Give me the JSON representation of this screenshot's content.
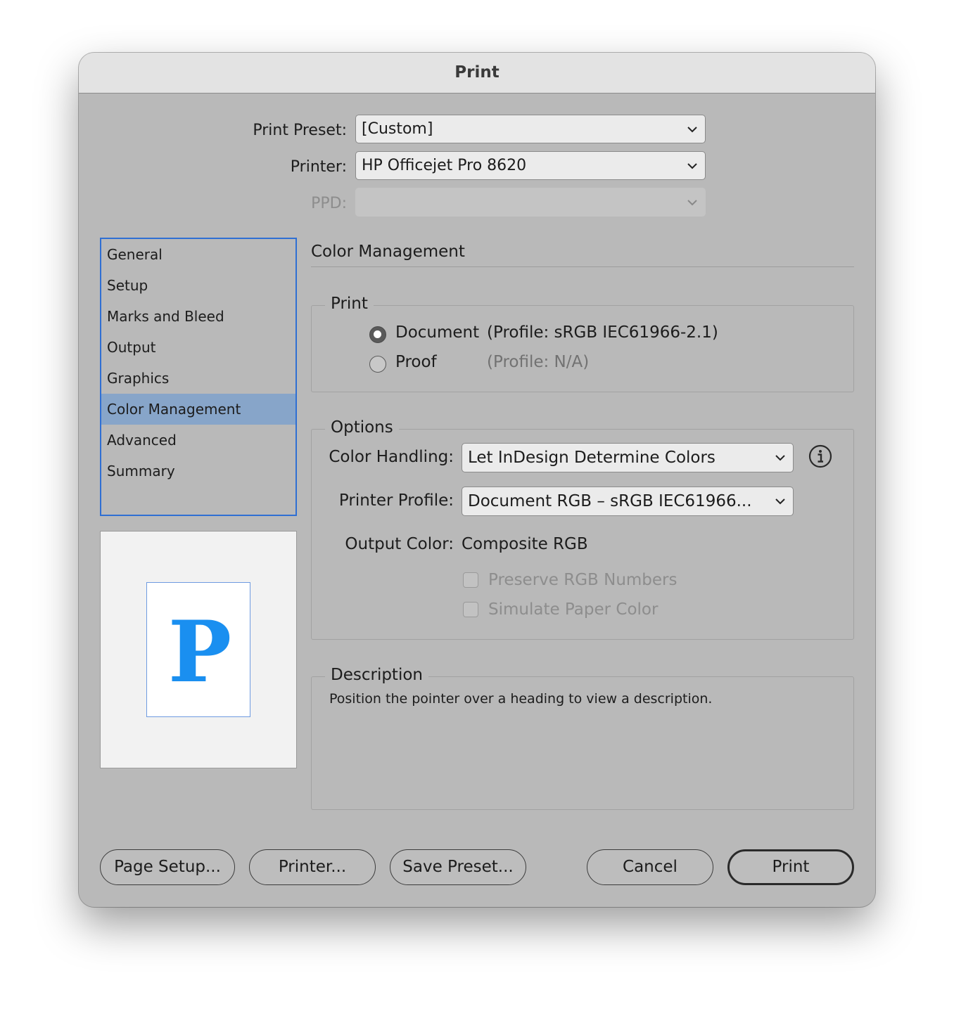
{
  "window": {
    "title": "Print"
  },
  "header": {
    "print_preset": {
      "label": "Print Preset:",
      "value": "[Custom]"
    },
    "printer": {
      "label": "Printer:",
      "value": "HP Officejet Pro 8620"
    },
    "ppd": {
      "label": "PPD:",
      "value": ""
    }
  },
  "sidebar": {
    "items": [
      {
        "label": "General",
        "selected": false
      },
      {
        "label": "Setup",
        "selected": false
      },
      {
        "label": "Marks and Bleed",
        "selected": false
      },
      {
        "label": "Output",
        "selected": false
      },
      {
        "label": "Graphics",
        "selected": false
      },
      {
        "label": "Color Management",
        "selected": true
      },
      {
        "label": "Advanced",
        "selected": false
      },
      {
        "label": "Summary",
        "selected": false
      }
    ],
    "selection_color": "#87a5c9",
    "border_color": "#2f6fd3"
  },
  "preview": {
    "glyph": "P",
    "glyph_color": "#1a8ff0"
  },
  "main": {
    "section_title": "Color Management",
    "print_group": {
      "legend": "Print",
      "document": {
        "label": "Document",
        "profile": "(Profile: sRGB IEC61966-2.1)",
        "checked": true
      },
      "proof": {
        "label": "Proof",
        "profile": "(Profile: N/A)",
        "checked": false
      }
    },
    "options_group": {
      "legend": "Options",
      "color_handling": {
        "label": "Color Handling:",
        "value": "Let InDesign Determine Colors"
      },
      "printer_profile": {
        "label": "Printer Profile:",
        "value": "Document RGB – sRGB IEC61966..."
      },
      "output_color": {
        "label": "Output Color:",
        "value": "Composite RGB"
      },
      "preserve_rgb": {
        "label": "Preserve RGB Numbers",
        "checked": false,
        "enabled": false
      },
      "simulate_paper": {
        "label": "Simulate Paper Color",
        "checked": false,
        "enabled": false
      }
    },
    "description_group": {
      "legend": "Description",
      "text": "Position the pointer over a heading to view a description."
    }
  },
  "footer": {
    "page_setup": "Page Setup...",
    "printer": "Printer...",
    "save_preset": "Save Preset...",
    "cancel": "Cancel",
    "print": "Print"
  }
}
